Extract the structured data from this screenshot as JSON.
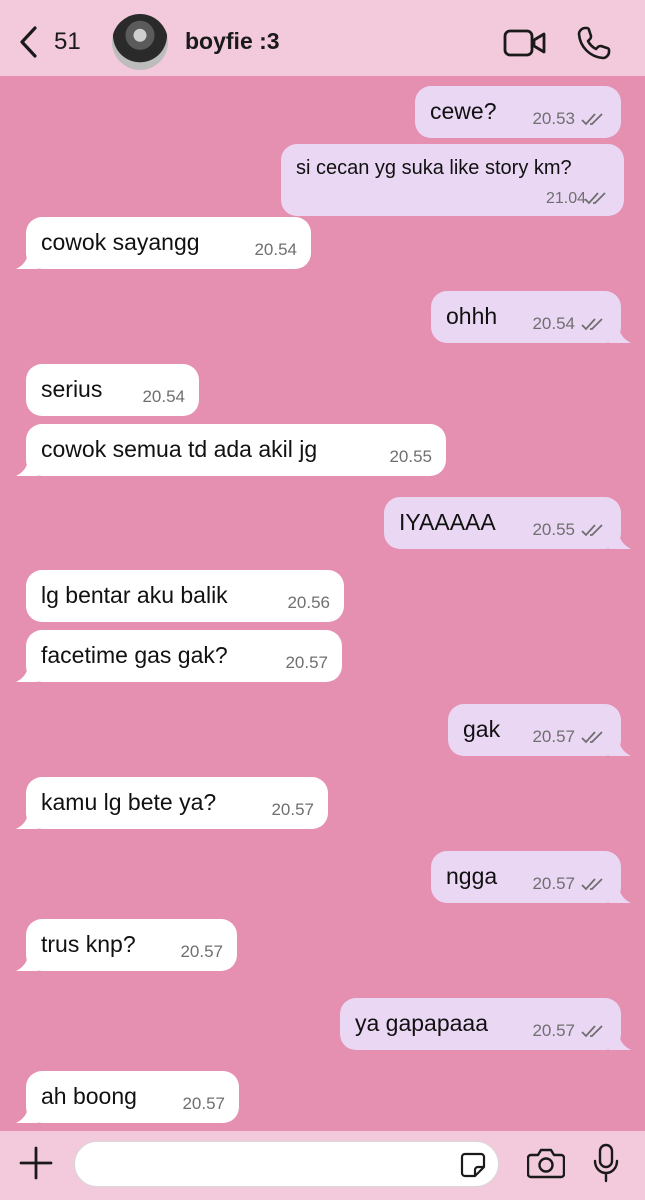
{
  "header": {
    "back_count": "51",
    "contact_name": "boyfie :3"
  },
  "messages": [
    {
      "dir": "out",
      "text": "cewe?",
      "time": "20.53",
      "read": true
    },
    {
      "dir": "out",
      "text": "si cecan yg suka like story km?",
      "time": "21.04",
      "read": true
    },
    {
      "dir": "in",
      "text": "cowok sayangg",
      "time": "20.54"
    },
    {
      "dir": "out",
      "text": "ohhh",
      "time": "20.54",
      "read": true
    },
    {
      "dir": "in",
      "text": "serius",
      "time": "20.54"
    },
    {
      "dir": "in",
      "text": "cowok semua td ada akil jg",
      "time": "20.55"
    },
    {
      "dir": "out",
      "text": "IYAAAAA",
      "time": "20.55",
      "read": true
    },
    {
      "dir": "in",
      "text": "lg bentar aku balik",
      "time": "20.56"
    },
    {
      "dir": "in",
      "text": "facetime gas gak?",
      "time": "20.57"
    },
    {
      "dir": "out",
      "text": "gak",
      "time": "20.57",
      "read": true
    },
    {
      "dir": "in",
      "text": "kamu lg bete ya?",
      "time": "20.57"
    },
    {
      "dir": "out",
      "text": "ngga",
      "time": "20.57",
      "read": true
    },
    {
      "dir": "in",
      "text": "trus knp?",
      "time": "20.57"
    },
    {
      "dir": "out",
      "text": "ya gapapaaa",
      "time": "20.57",
      "read": true
    },
    {
      "dir": "in",
      "text": "ah boong",
      "time": "20.57"
    }
  ],
  "composer": {
    "placeholder": ""
  },
  "colors": {
    "chat_background": "#e58fb1",
    "bar_background": "#f3cadb",
    "incoming_bubble": "#ffffff",
    "outgoing_bubble": "#ead7f4",
    "read_ticks": "#6f6f6f"
  },
  "icons": [
    "back-chevron-icon",
    "avatar",
    "video-call-icon",
    "phone-icon",
    "plus-icon",
    "sticker-icon",
    "camera-icon",
    "microphone-icon",
    "double-check-icon"
  ]
}
